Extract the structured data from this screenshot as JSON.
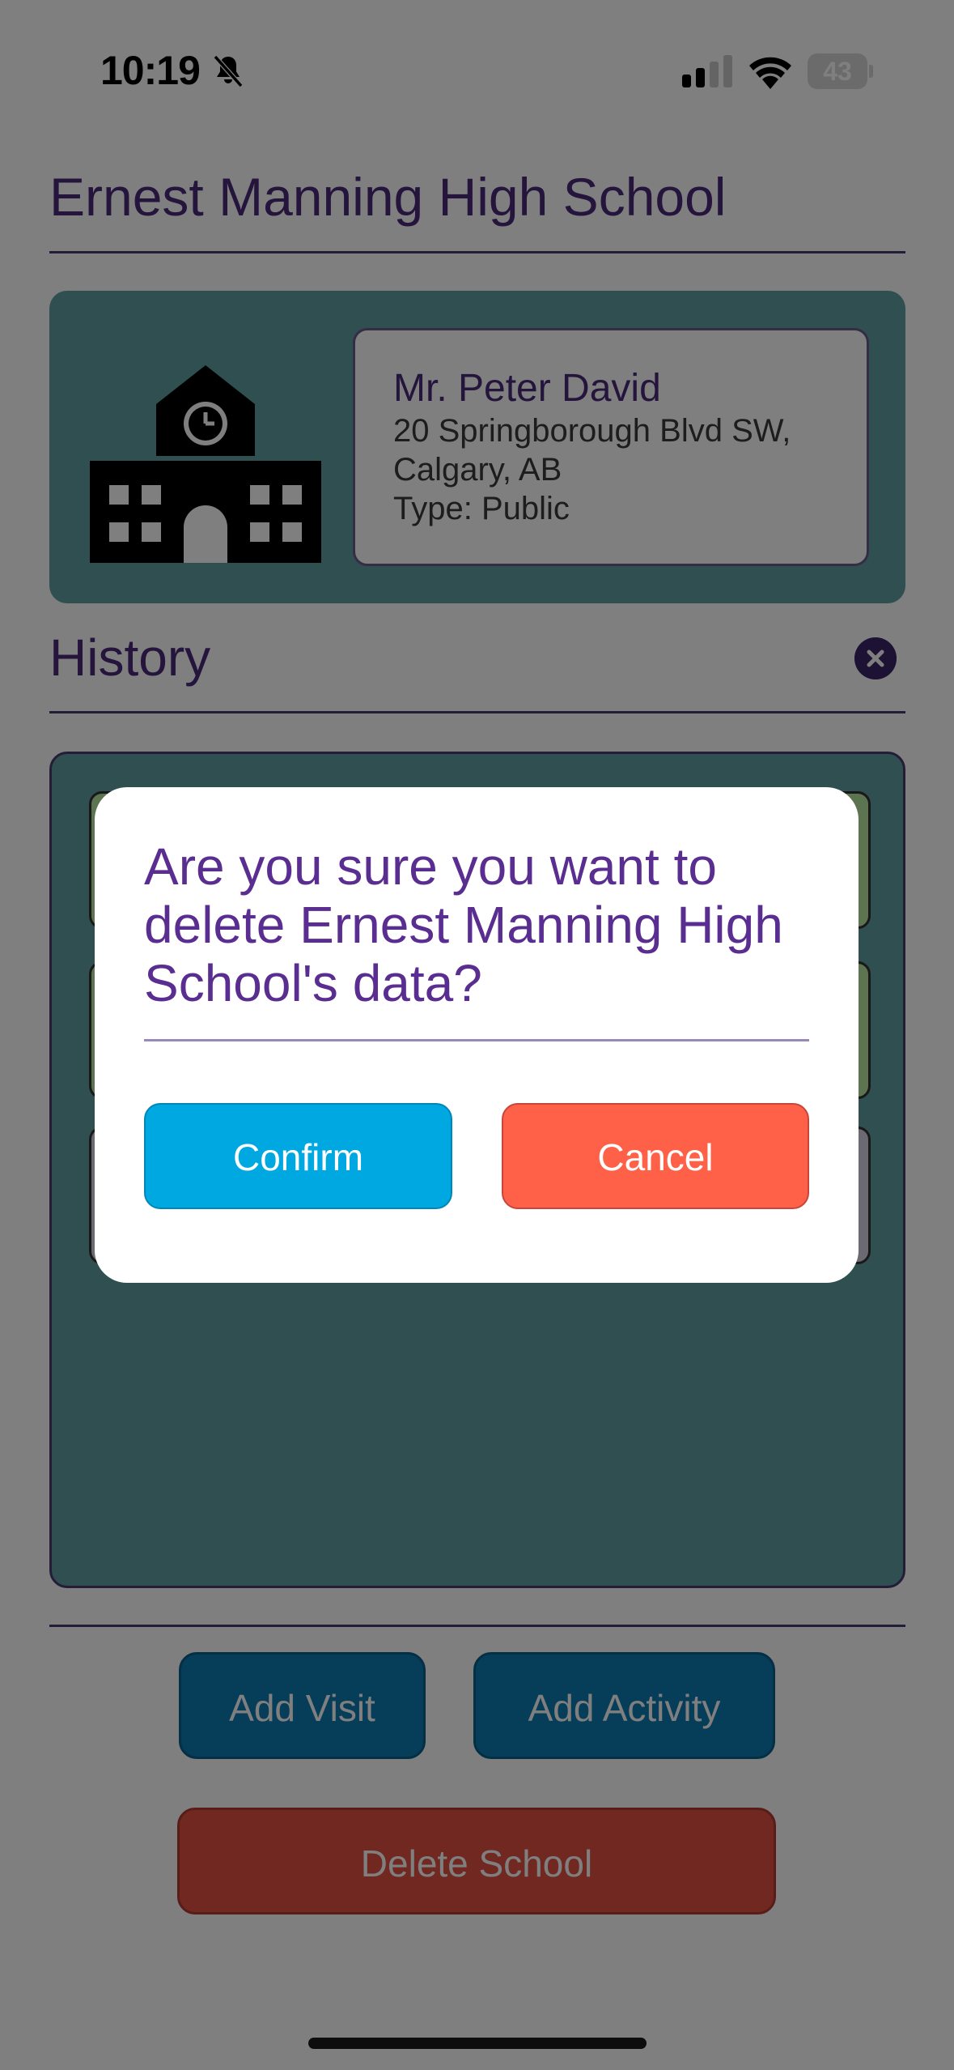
{
  "status_bar": {
    "time": "10:19",
    "battery_percent": "43"
  },
  "school": {
    "name": "Ernest Manning High School",
    "principal": "Mr. Peter David",
    "address": "20 Springborough Blvd SW, Calgary, AB",
    "type_line": "Type: Public"
  },
  "history": {
    "title": "History"
  },
  "actions": {
    "add_visit": "Add Visit",
    "add_activity": "Add Activity",
    "delete_school": "Delete School"
  },
  "modal": {
    "question": "Are you sure you want to delete Ernest Manning High School's data?",
    "confirm": "Confirm",
    "cancel": "Cancel"
  },
  "colors": {
    "accent_purple": "#5a2d91",
    "confirm_blue": "#00a8e1",
    "cancel_red": "#ff6148",
    "card_teal": "#5f9ea0"
  },
  "icons": [
    "bell-slash-icon",
    "signal-icon",
    "wifi-icon",
    "battery-icon",
    "school-building-icon",
    "close-icon"
  ]
}
